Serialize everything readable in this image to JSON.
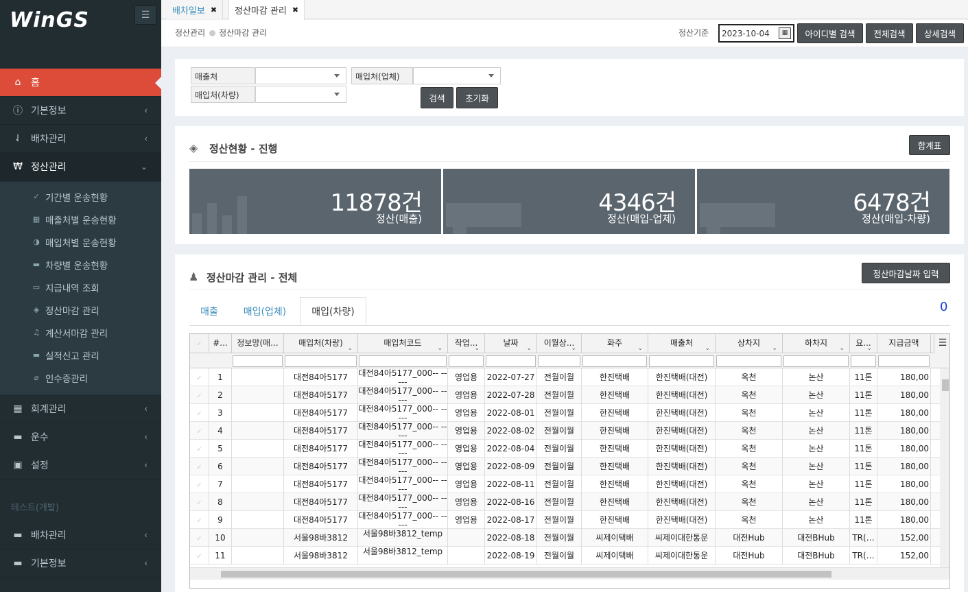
{
  "sidebar": {
    "logo": "WinGS",
    "menu": [
      {
        "label": "홈",
        "icon": "home-icon"
      },
      {
        "label": "기본정보",
        "icon": "info-icon"
      },
      {
        "label": "배차관리",
        "icon": "sort-icon"
      },
      {
        "label": "정산관리",
        "icon": "won-icon"
      }
    ],
    "submenu": [
      {
        "label": "기간별 운송현황",
        "icon": "check-circle-icon"
      },
      {
        "label": "매출처별 운송현황",
        "icon": "building-icon"
      },
      {
        "label": "매입처별 운송현황",
        "icon": "half-circle-icon"
      },
      {
        "label": "차량별 운송현황",
        "icon": "truck-icon"
      },
      {
        "label": "지급내역 조회",
        "icon": "money-icon"
      },
      {
        "label": "정산마감 관리",
        "icon": "tags-icon"
      },
      {
        "label": "계산서마감 관리",
        "icon": "bell-icon"
      },
      {
        "label": "실적신고 관리",
        "icon": "coffee-icon"
      },
      {
        "label": "인수증관리",
        "icon": "paperclip-icon"
      }
    ],
    "menu2": [
      {
        "label": "회계관리",
        "icon": "calculator-icon"
      },
      {
        "label": "운수",
        "icon": "coffee-icon"
      },
      {
        "label": "설정",
        "icon": "archive-icon"
      }
    ],
    "group_label": "테스트(개발)",
    "menu3": [
      {
        "label": "배차관리",
        "icon": "coffee-icon"
      },
      {
        "label": "기본정보",
        "icon": "coffee-icon"
      }
    ]
  },
  "tabs": [
    {
      "label": "배차일보"
    },
    {
      "label": "정산마감 관리"
    }
  ],
  "header": {
    "breadcrumb_root": "정산관리",
    "breadcrumb_current": "정산마감 관리",
    "base_label": "정산기준",
    "base_date": "2023-10-04",
    "btn_id_search": "아이디별 검색",
    "btn_all_search": "전체검색",
    "btn_detail_search": "상세검색"
  },
  "filters": {
    "sales_label": "매출처",
    "buyer_company_label": "매입처(업체)",
    "buyer_vehicle_label": "매입처(차량)",
    "search_btn": "검색",
    "reset_btn": "초기화"
  },
  "status_panel": {
    "title": "정산현황 - 진행",
    "sum_btn": "합계표",
    "cards": [
      {
        "count": "11878건",
        "caption": "정산(매출)"
      },
      {
        "count": "4346건",
        "caption": "정산(매입-업체)"
      },
      {
        "count": "6478건",
        "caption": "정산(매입-차량)"
      }
    ]
  },
  "close_panel": {
    "title": "정산마감 관리 - 전체",
    "date_btn": "정산마감날짜 입력",
    "tabs": [
      "매출",
      "매입(업체)",
      "매입(차량)"
    ],
    "count": "0"
  },
  "grid": {
    "columns": [
      "#...",
      "정보망(매...",
      "매입처(차량)",
      "매입처코드",
      "작업...",
      "날짜",
      "이월상...",
      "화주",
      "매출처",
      "상차지",
      "하차지",
      "요...",
      "지급금액"
    ],
    "rows": [
      [
        "1",
        "",
        "대전84아5177",
        "대전84아5177_000-- -----",
        "영업용",
        "2022-07-27",
        "전월이월",
        "한진택배",
        "한진택배(대전)",
        "옥천",
        "논산",
        "11톤",
        "180,00"
      ],
      [
        "2",
        "",
        "대전84아5177",
        "대전84아5177_000-- -----",
        "영업용",
        "2022-07-28",
        "전월이월",
        "한진택배",
        "한진택배(대전)",
        "옥천",
        "논산",
        "11톤",
        "180,00"
      ],
      [
        "3",
        "",
        "대전84아5177",
        "대전84아5177_000-- -----",
        "영업용",
        "2022-08-01",
        "전월이월",
        "한진택배",
        "한진택배(대전)",
        "옥천",
        "논산",
        "11톤",
        "180,00"
      ],
      [
        "4",
        "",
        "대전84아5177",
        "대전84아5177_000-- -----",
        "영업용",
        "2022-08-02",
        "전월이월",
        "한진택배",
        "한진택배(대전)",
        "옥천",
        "논산",
        "11톤",
        "180,00"
      ],
      [
        "5",
        "",
        "대전84아5177",
        "대전84아5177_000-- -----",
        "영업용",
        "2022-08-04",
        "전월이월",
        "한진택배",
        "한진택배(대전)",
        "옥천",
        "논산",
        "11톤",
        "180,00"
      ],
      [
        "6",
        "",
        "대전84아5177",
        "대전84아5177_000-- -----",
        "영업용",
        "2022-08-09",
        "전월이월",
        "한진택배",
        "한진택배(대전)",
        "옥천",
        "논산",
        "11톤",
        "180,00"
      ],
      [
        "7",
        "",
        "대전84아5177",
        "대전84아5177_000-- -----",
        "영업용",
        "2022-08-11",
        "전월이월",
        "한진택배",
        "한진택배(대전)",
        "옥천",
        "논산",
        "11톤",
        "180,00"
      ],
      [
        "8",
        "",
        "대전84아5177",
        "대전84아5177_000-- -----",
        "영업용",
        "2022-08-16",
        "전월이월",
        "한진택배",
        "한진택배(대전)",
        "옥천",
        "논산",
        "11톤",
        "180,00"
      ],
      [
        "9",
        "",
        "대전84아5177",
        "대전84아5177_000-- -----",
        "영업용",
        "2022-08-17",
        "전월이월",
        "한진택배",
        "한진택배(대전)",
        "옥천",
        "논산",
        "11톤",
        "180,00"
      ],
      [
        "10",
        "",
        "서울98바3812",
        "서울98바3812_temp",
        "",
        "2022-08-18",
        "전월이월",
        "씨제이택배",
        "씨제이대한통운",
        "대전Hub",
        "대전BHub",
        "TR(…",
        "152,00"
      ],
      [
        "11",
        "",
        "서울98바3812",
        "서울98바3812_temp",
        "",
        "2022-08-19",
        "전월이월",
        "씨제이택배",
        "씨제이대한통운",
        "대전Hub",
        "대전BHub",
        "TR(…",
        "152,00"
      ]
    ]
  }
}
